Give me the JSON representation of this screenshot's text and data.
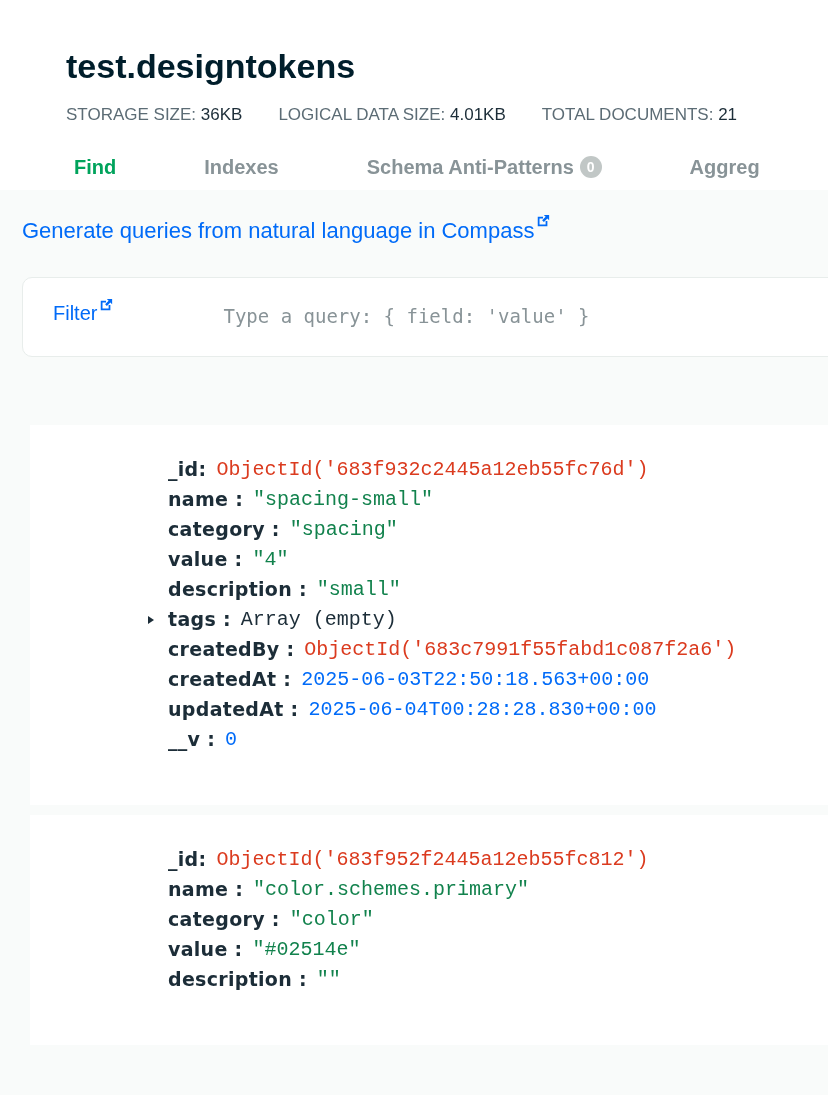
{
  "header": {
    "title": "test.designtokens",
    "stats": [
      {
        "label": "STORAGE SIZE:",
        "value": "36KB"
      },
      {
        "label": "LOGICAL DATA SIZE:",
        "value": "4.01KB"
      },
      {
        "label": "TOTAL DOCUMENTS:",
        "value": "21"
      }
    ]
  },
  "tabs": [
    {
      "label": "Find",
      "selected": true
    },
    {
      "label": "Indexes",
      "selected": false
    },
    {
      "label": "Schema Anti-Patterns",
      "selected": false,
      "badge": "0"
    },
    {
      "label": "Aggreg",
      "selected": false
    }
  ],
  "compass_link": "Generate queries from natural language in Compass",
  "filter": {
    "label": "Filter",
    "placeholder": "Type a query: { field: 'value' }"
  },
  "documents": [
    {
      "fields": [
        {
          "key": "_id:",
          "kind": "objectid",
          "value": "ObjectId('683f932c2445a12eb55fc76d')"
        },
        {
          "key": "name :",
          "kind": "string",
          "value": "\"spacing-small\""
        },
        {
          "key": "category :",
          "kind": "string",
          "value": "\"spacing\""
        },
        {
          "key": "value :",
          "kind": "string",
          "value": "\"4\""
        },
        {
          "key": "description :",
          "kind": "string",
          "value": "\"small\""
        },
        {
          "key": "tags :",
          "kind": "array",
          "value": "Array (empty)",
          "expanded": false
        },
        {
          "key": "createdBy :",
          "kind": "objectid",
          "value": "ObjectId('683c7991f55fabd1c087f2a6')"
        },
        {
          "key": "createdAt :",
          "kind": "date",
          "value": "2025-06-03T22:50:18.563+00:00"
        },
        {
          "key": "updatedAt :",
          "kind": "date",
          "value": "2025-06-04T00:28:28.830+00:00"
        },
        {
          "key": "__v :",
          "kind": "number",
          "value": "0"
        }
      ]
    },
    {
      "fields": [
        {
          "key": "_id:",
          "kind": "objectid",
          "value": "ObjectId('683f952f2445a12eb55fc812')"
        },
        {
          "key": "name :",
          "kind": "string",
          "value": "\"color.schemes.primary\""
        },
        {
          "key": "category :",
          "kind": "string",
          "value": "\"color\""
        },
        {
          "key": "value :",
          "kind": "string",
          "value": "\"#02514e\""
        },
        {
          "key": "description :",
          "kind": "string",
          "value": "\"\""
        }
      ]
    }
  ]
}
